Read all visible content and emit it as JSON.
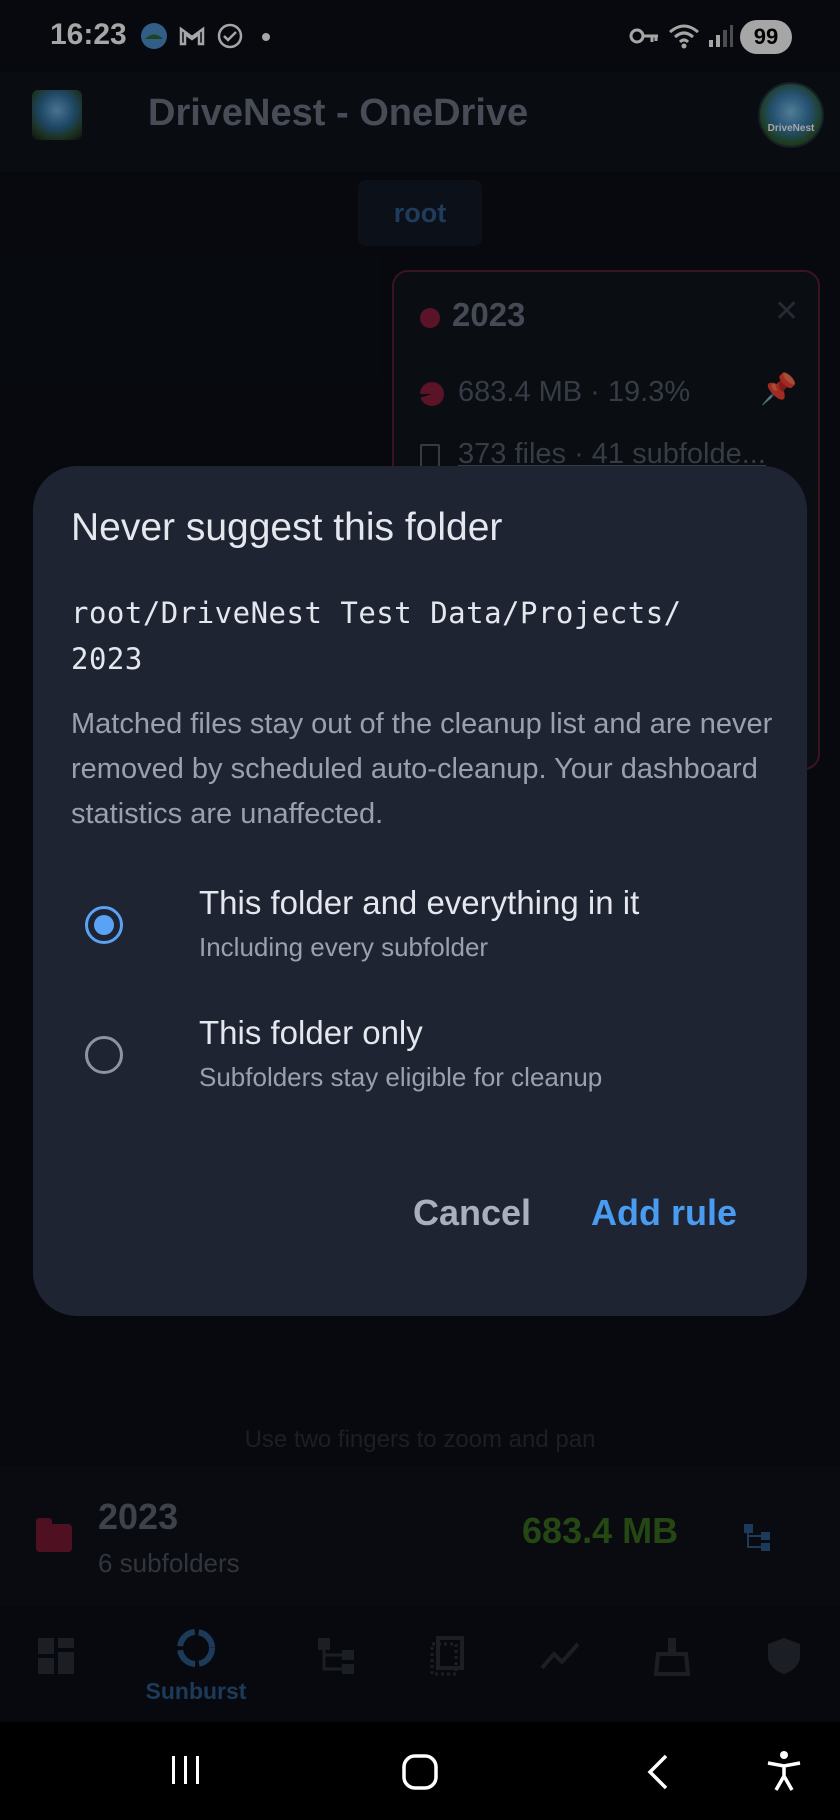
{
  "status_bar": {
    "time": "16:23",
    "battery": "99",
    "notification_icons": [
      "drivenest-icon",
      "gmail-icon",
      "check-circle-icon"
    ],
    "system_icons": [
      "key-icon",
      "wifi-icon",
      "signal-icon"
    ]
  },
  "app_bar": {
    "title": "DriveNest - OneDrive",
    "avatar_text": "DriveNest"
  },
  "breadcrumb": {
    "root": "root"
  },
  "info_card": {
    "title": "2023",
    "size": "683.4 MB  ·  19.3%",
    "files": "373 files  ·  41 subfolde..."
  },
  "hint": "Use two fingers to zoom and pan",
  "folder_bar": {
    "name": "2023",
    "subtitle": "6 subfolders",
    "size": "683.4 MB"
  },
  "bottom_nav": {
    "active_label": "Sunburst",
    "items": [
      "dashboard-icon",
      "sunburst-icon",
      "tree-icon",
      "files-icon",
      "trend-icon",
      "cleanup-icon",
      "shield-icon"
    ]
  },
  "dialog": {
    "title": "Never suggest this folder",
    "path": "root/DriveNest Test Data/Projects/ 2023",
    "description": "Matched files stay out of the cleanup list and are never removed by scheduled auto-cleanup. Your dashboard statistics are unaffected.",
    "options": [
      {
        "label": "This folder and everything in it",
        "sublabel": "Including every subfolder",
        "selected": true
      },
      {
        "label": "This folder only",
        "sublabel": "Subfolders stay eligible for cleanup",
        "selected": false
      }
    ],
    "cancel_label": "Cancel",
    "confirm_label": "Add rule"
  },
  "colors": {
    "accent": "#4a9cf2",
    "dialog_bg": "#1f2432",
    "folder_accent": "#7a1a34",
    "size_green": "#3a6e1e"
  }
}
